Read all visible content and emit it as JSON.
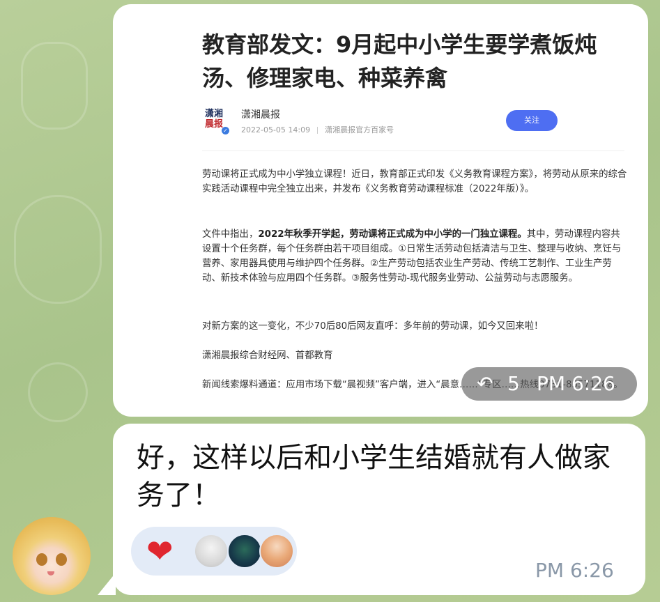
{
  "forwarded_image": {
    "article": {
      "title": "教育部发文：9月起中小学生要学煮饭炖汤、修理家电、种菜养禽",
      "author_logo_top": "潇湘",
      "author_logo_bottom": "晨报",
      "author": "潇湘晨报",
      "date": "2022-05-05 14:09",
      "source": "潇湘晨报官方百家号",
      "follow_label": "关注",
      "paragraphs": {
        "p1": "劳动课将正式成为中小学独立课程！近日，教育部正式印发《义务教育课程方案》，将劳动从原来的综合实践活动课程中完全独立出来，并发布《义务教育劳动课程标准（2022年版）》。",
        "p2_prefix": "文件中指出，",
        "p2_bold": "2022年秋季开学起，劳动课将正式成为中小学的一门独立课程。",
        "p2_rest": "其中，劳动课程内容共设置十个任务群，每个任务群由若干项目组成。①日常生活劳动包括清洁与卫生、整理与收纳、烹饪与营养、家用器具使用与维护四个任务群。②生产劳动包括农业生产劳动、传统工艺制作、工业生产劳动、新技术体验与应用四个任务群。③服务性劳动-现代服务业劳动、公益劳动与志愿服务。",
        "p3": "对新方案的这一变化，不少70后80后网友直呼：多年前的劳动课，如今又回来啦！",
        "p4": "潇湘晨报综合财经网、首都教育",
        "p5": "新闻线索爆料通道：应用市场下载“晨视频”客户端，进入“晨意……”专区……热线0731-85571188。"
      }
    },
    "overlay": {
      "forward_icon": "reply-arrow-icon",
      "views": "5",
      "time": "PM 6:26"
    }
  },
  "message": {
    "text": "好，这样以后和小学生结婚就有人做家务了！",
    "time": "PM 6:26",
    "reactions": {
      "emoji": "❤️",
      "reactor_avatars": [
        "reactor-avatar-1",
        "reactor-avatar-2",
        "reactor-avatar-3"
      ]
    }
  },
  "sender": {
    "avatar": "anime-girl-avatar"
  },
  "colors": {
    "chat_background": "#b3ca92",
    "bubble": "#ffffff",
    "follow_button": "#4e6ef2",
    "heart": "#e0262f",
    "reaction_pill": "#e3ebf7",
    "time_text": "#8a98a8"
  }
}
